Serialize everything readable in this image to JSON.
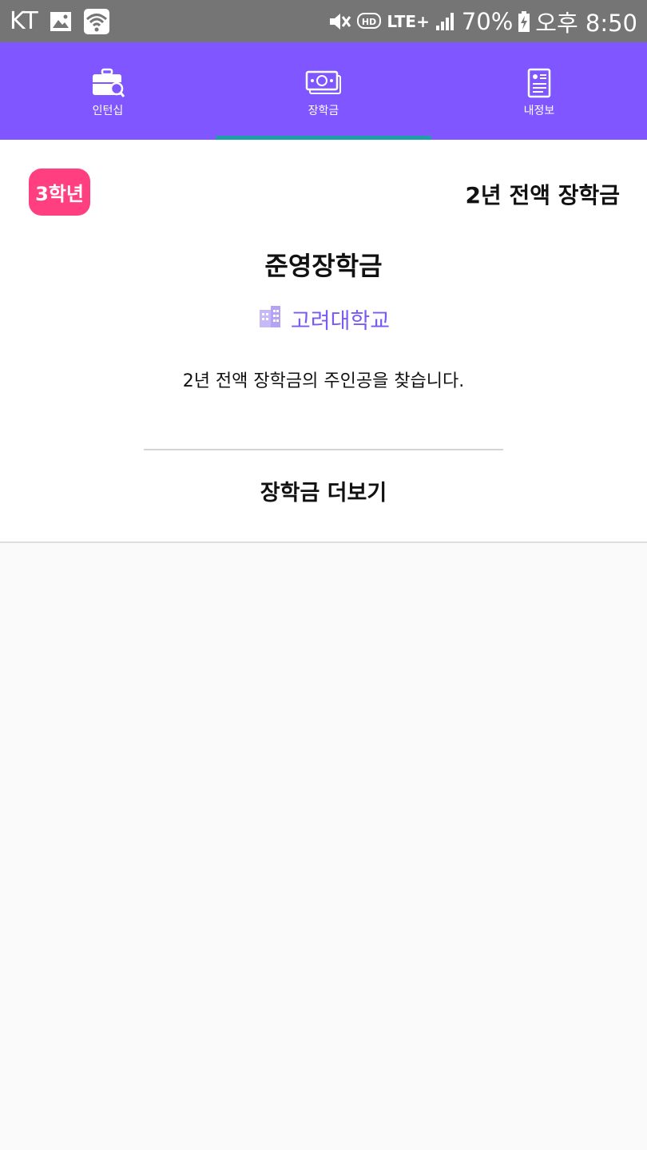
{
  "status_bar": {
    "carrier": "KT",
    "network": "LTE+",
    "battery": "70%",
    "time": "오후 8:50",
    "icons": [
      "image-icon",
      "wifi-icon",
      "mute-icon",
      "hd-icon",
      "lte-icon",
      "signal-icon",
      "battery-charging-icon"
    ]
  },
  "tabs": [
    {
      "label": "인턴십",
      "icon": "briefcase-search-icon",
      "active": false
    },
    {
      "label": "장학금",
      "icon": "money-stack-icon",
      "active": true
    },
    {
      "label": "내정보",
      "icon": "profile-card-icon",
      "active": false
    }
  ],
  "colors": {
    "tab_bar": "#7f56ff",
    "tab_indicator": "#1f9ea9",
    "badge": "#ff3f7f",
    "school_text": "#7a5af0",
    "status_bar": "#757575"
  },
  "card": {
    "grade_badge": "3학년",
    "benefit": "2년 전액 장학금",
    "title": "준영장학금",
    "school": "고려대학교",
    "school_icon": "building-icon",
    "description": "2년 전액 장학금의 주인공을 찾습니다.",
    "more_button": "장학금 더보기"
  }
}
